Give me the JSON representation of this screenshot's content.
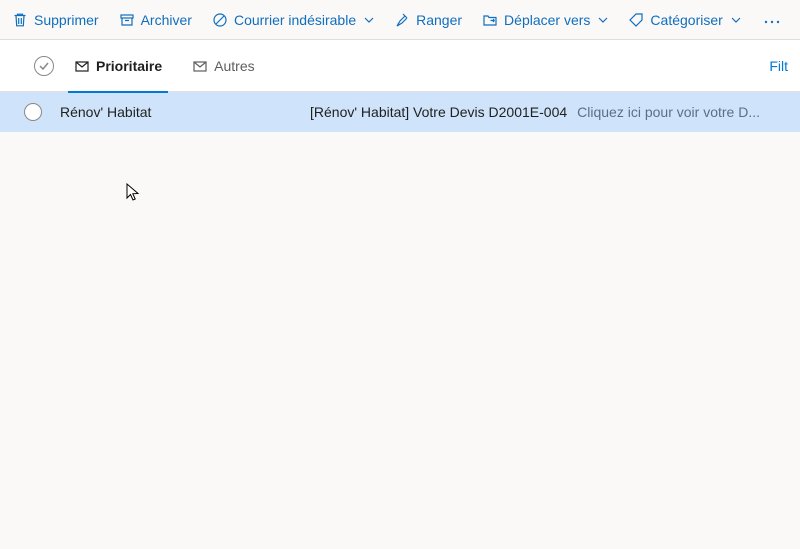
{
  "toolbar": {
    "delete": "Supprimer",
    "archive": "Archiver",
    "junk": "Courrier indésirable",
    "sweep": "Ranger",
    "move": "Déplacer vers",
    "categorize": "Catégoriser"
  },
  "tabs": {
    "focused": "Prioritaire",
    "other": "Autres",
    "filter": "Filt"
  },
  "messages": [
    {
      "sender": "Rénov' Habitat",
      "subject": "[Rénov' Habitat] Votre Devis D2001E-004",
      "preview": "Cliquez ici pour voir votre D..."
    }
  ]
}
